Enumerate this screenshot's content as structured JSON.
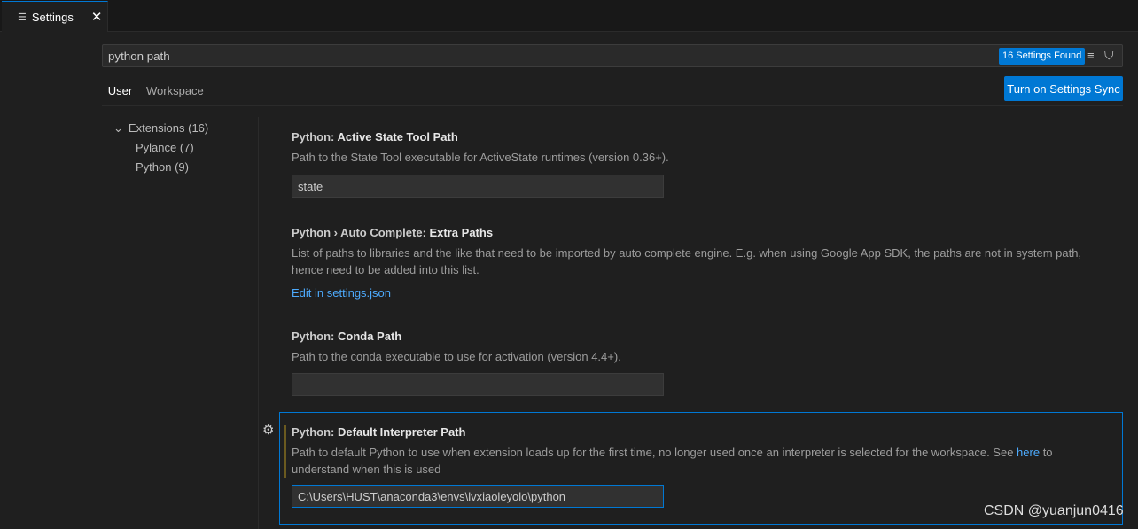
{
  "tab": {
    "title": "Settings",
    "icon": "settings-editor-icon",
    "close": "✕"
  },
  "search": {
    "value": "python path",
    "found": "16 Settings Found"
  },
  "scopes": {
    "user": "User",
    "workspace": "Workspace"
  },
  "sync_button": "Turn on Settings Sync",
  "tree": {
    "extensions": "Extensions (16)",
    "pylance": "Pylance (7)",
    "python": "Python (9)"
  },
  "settings": [
    {
      "category": "Python: ",
      "name": "Active State Tool Path",
      "desc": "Path to the State Tool executable for ActiveState runtimes (version 0.36+).",
      "value": "state"
    },
    {
      "category": "Python › Auto Complete: ",
      "name": "Extra Paths",
      "desc": "List of paths to libraries and the like that need to be imported by auto complete engine. E.g. when using Google App SDK, the paths are not in system path, hence need to be added into this list.",
      "link": "Edit in settings.json"
    },
    {
      "category": "Python: ",
      "name": "Conda Path",
      "desc": "Path to the conda executable to use for activation (version 4.4+).",
      "value": ""
    },
    {
      "category": "Python: ",
      "name": "Default Interpreter Path",
      "desc_a": "Path to default Python to use when extension loads up for the first time, no longer used once an interpreter is selected for the workspace. See ",
      "link": "here",
      "desc_b": " to understand when this is used",
      "value": "C:\\Users\\HUST\\anaconda3\\envs\\lvxiaoleyolo\\python"
    }
  ],
  "watermark": "CSDN @yuanjun0416",
  "colors": {
    "accent": "#0078d4",
    "background": "#1f1f1f",
    "link": "#4daafc"
  }
}
